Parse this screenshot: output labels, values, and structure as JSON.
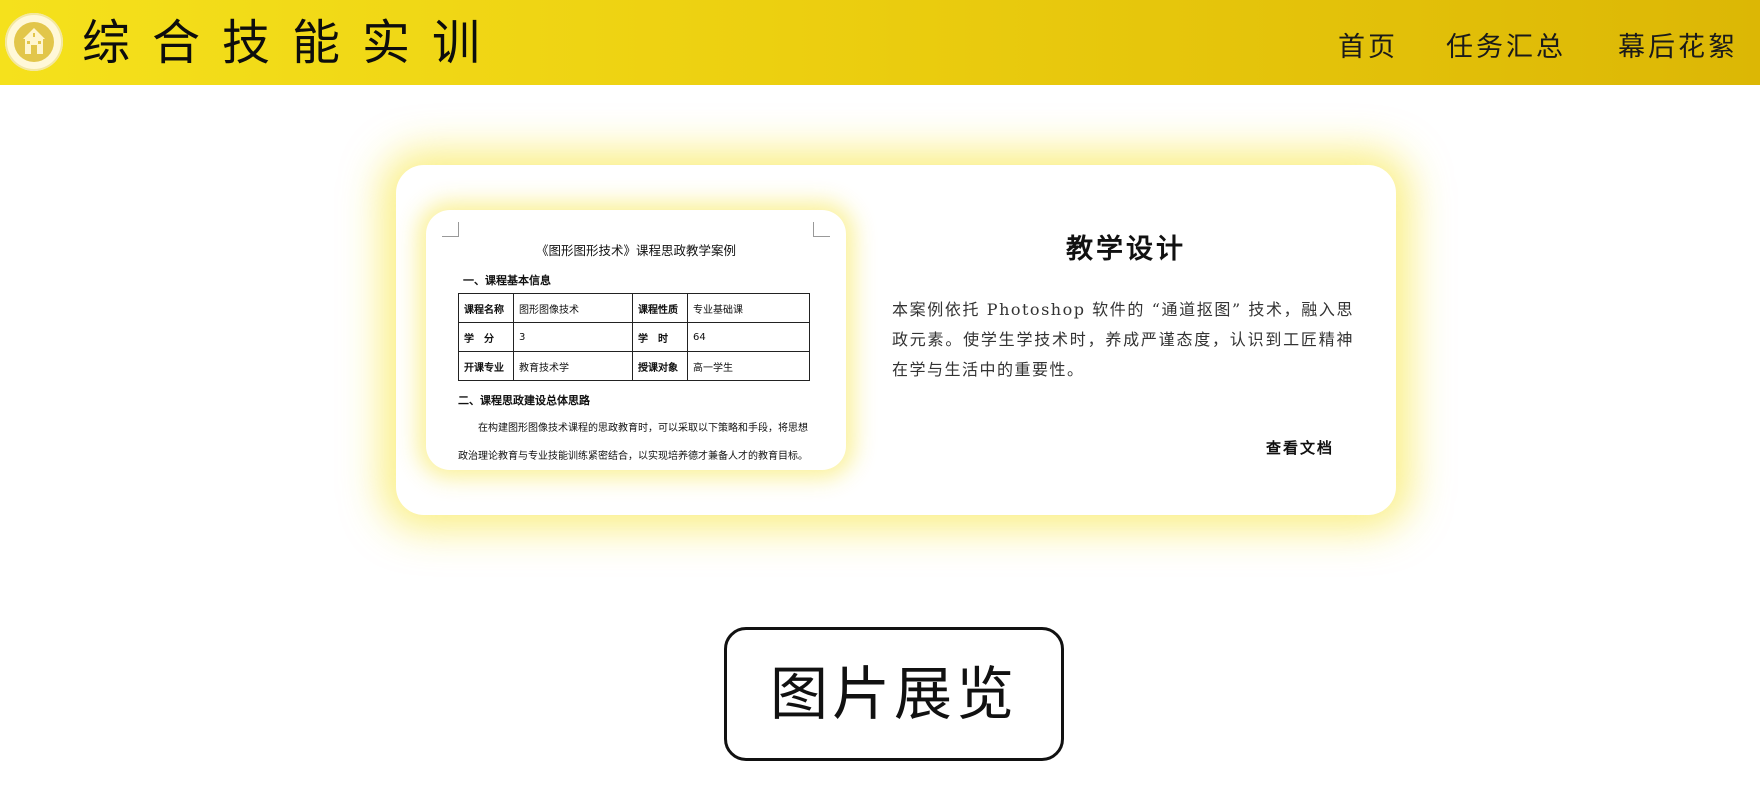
{
  "header": {
    "site_title": "综合技能实训",
    "nav": [
      "首页",
      "任务汇总",
      "幕后花絮"
    ]
  },
  "card": {
    "document": {
      "title": "《图形图形技术》课程思政教学案例",
      "section1": "一、课程基本信息",
      "table": [
        [
          "课程名称",
          "图形图像技术",
          "课程性质",
          "专业基础课"
        ],
        [
          "学　分",
          "3",
          "学　时",
          "64"
        ],
        [
          "开课专业",
          "教育技术学",
          "授课对象",
          "高一学生"
        ]
      ],
      "section2": "二、课程思政建设总体思路",
      "paragraph": "在构建图形图像技术课程的思政教育时，可以采取以下策略和手段，将思想政治理论教育与专业技能训练紧密结合，以实现培养德才兼备人才的教育目标。"
    },
    "title": "教学设计",
    "description": "本案例依托 Photoshop 软件的 “通道抠图” 技术，融入思政元素。使学生学技术时，养成严谨态度，认识到工匠精神在学与生活中的重要性。",
    "link_label": "查看文档"
  },
  "section": {
    "title": "图片展览"
  },
  "colors": {
    "header_start": "#f5e11c",
    "header_end": "#dcb705",
    "glow": "#f5e11e"
  },
  "icons": {
    "logo": "school-building-icon"
  }
}
